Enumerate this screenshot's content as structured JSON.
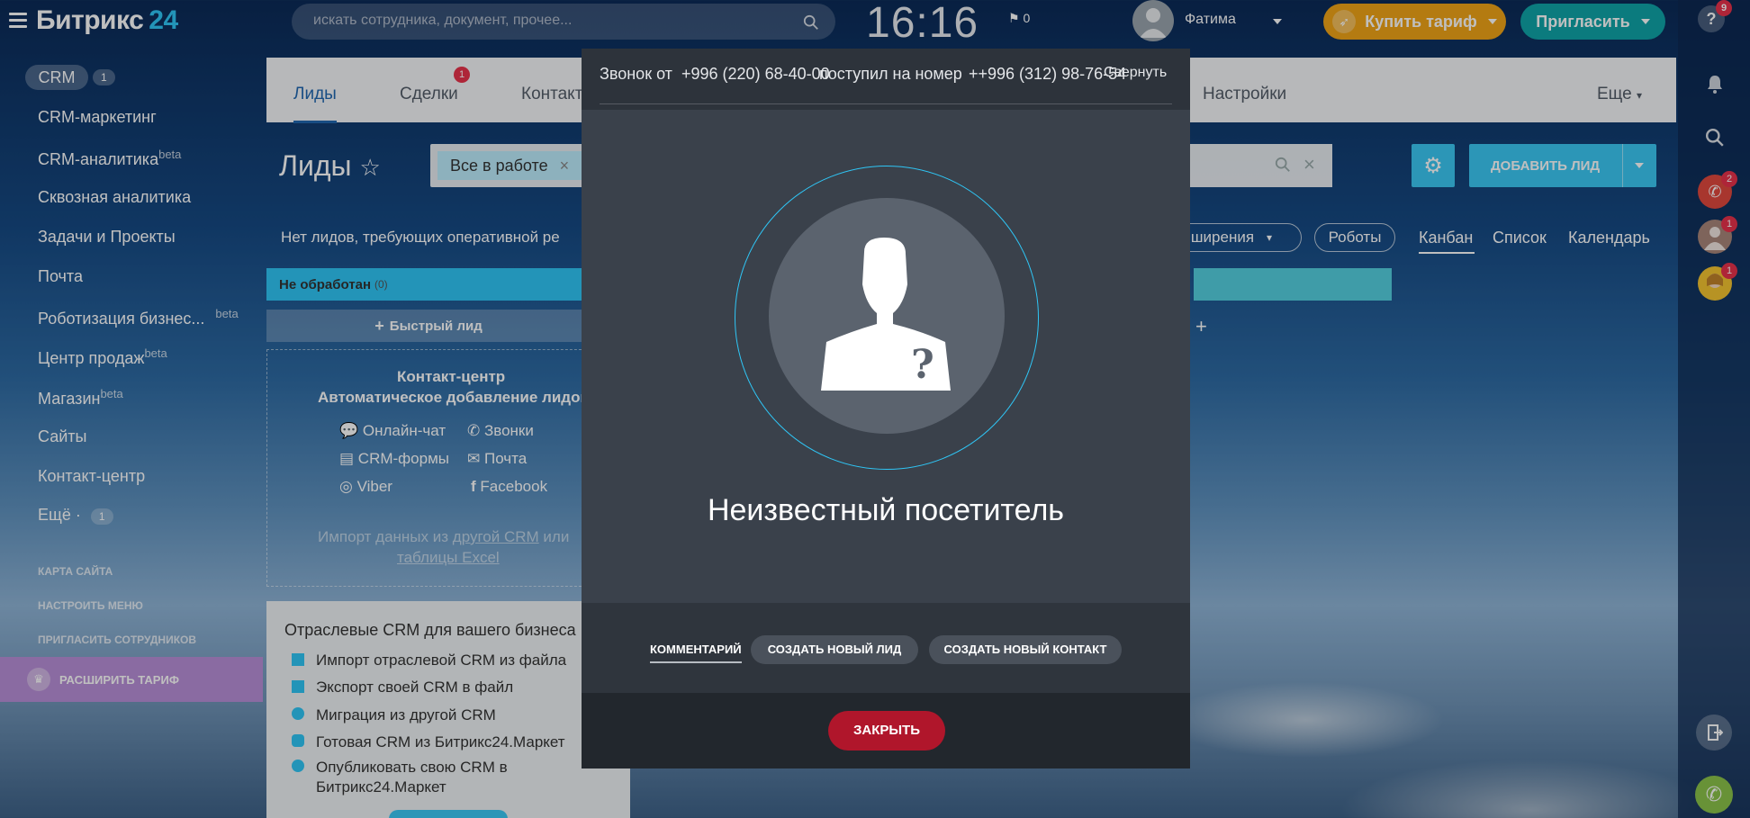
{
  "topbar": {
    "logo_main": "Битрикс",
    "logo_num": "24",
    "search_placeholder": "искать сотрудника, документ, прочее...",
    "time": "16:16",
    "flag_count": "0",
    "user_name": "Фатима",
    "buy_label": "Купить тариф",
    "invite_label": "Пригласить"
  },
  "rail": {
    "help_badge": "9",
    "calls_badge": "2",
    "contact_badge": "1",
    "avatar2_badge": "1"
  },
  "sidebar": {
    "crm_label": "CRM",
    "crm_count": "1",
    "items": [
      {
        "label": "CRM-маркетинг",
        "sup": ""
      },
      {
        "label": "CRM-аналитика",
        "sup": "beta"
      },
      {
        "label": "Сквозная аналитика",
        "sup": ""
      },
      {
        "label": "Задачи и Проекты",
        "sup": ""
      },
      {
        "label": "Почта",
        "sup": ""
      },
      {
        "label": "Роботизация бизнес...",
        "sup": "beta"
      },
      {
        "label": "Центр продаж",
        "sup": "beta"
      },
      {
        "label": "Магазин",
        "sup": "beta"
      },
      {
        "label": "Сайты",
        "sup": ""
      },
      {
        "label": "Контакт-центр",
        "sup": ""
      }
    ],
    "more_label": "Ещё ·",
    "more_count": "1",
    "sitemap": "КАРТА САЙТА",
    "configure": "НАСТРОИТЬ МЕНЮ",
    "invite_staff": "ПРИГЛАСИТЬ СОТРУДНИКОВ",
    "upgrade": "РАСШИРИТЬ ТАРИФ"
  },
  "crm": {
    "tabs": {
      "leads": "Лиды",
      "deals": "Сделки",
      "deals_badge": "1",
      "contacts": "Контакт",
      "settings": "Настройки",
      "more": "Еще"
    },
    "title": "Лиды",
    "filter_chip": "Все в работе",
    "add_lead": "ДОБАВИТЬ ЛИД",
    "subline": "Нет лидов, требующих оперативной ре",
    "extensions": "ширения",
    "robots": "Роботы",
    "views": [
      "Канбан",
      "Список",
      "Календарь"
    ],
    "column_title": "Не обработан",
    "column_count": "(0)",
    "quick_lead": "Быстрый лид",
    "contact_center": {
      "title": "Контакт-центр",
      "subtitle": "Автоматическое добавление лидов",
      "channels": [
        "Онлайн-чат",
        "Звонки",
        "CRM-формы",
        "Почта",
        "Viber",
        "Facebook"
      ],
      "import_pre": "Импорт данных из",
      "import_link": "другой CRM",
      "import_mid": "или",
      "import_link2": "таблицы Excel"
    },
    "industry": {
      "title": "Отраслевые CRM для вашего бизнеса",
      "items": [
        "Импорт отраслевой CRM из файла",
        "Экспорт своей CRM в файл",
        "Миграция из другой CRM",
        "Готовая CRM из Битрикс24.Маркет",
        "Опубликовать свою CRM в",
        "Битрикс24.Маркет"
      ]
    }
  },
  "call": {
    "from_label": "Звонок от",
    "from_number": "+996 (220) 68-40-00",
    "to_label": "поступил на номер",
    "to_number": "++996 (312) 98-76-54",
    "minimize": "Свернуть",
    "visitor": "Неизвестный посетитель",
    "comment_tab": "КОММЕНТАРИЙ",
    "new_lead": "СОЗДАТЬ НОВЫЙ ЛИД",
    "new_contact": "СОЗДАТЬ НОВЫЙ КОНТАКТ",
    "close": "ЗАКРЫТЬ"
  },
  "colors": {
    "accent": "#2fc6f6",
    "buy": "#f0a417",
    "invite": "#0fa5a9",
    "close": "#b0162b"
  }
}
